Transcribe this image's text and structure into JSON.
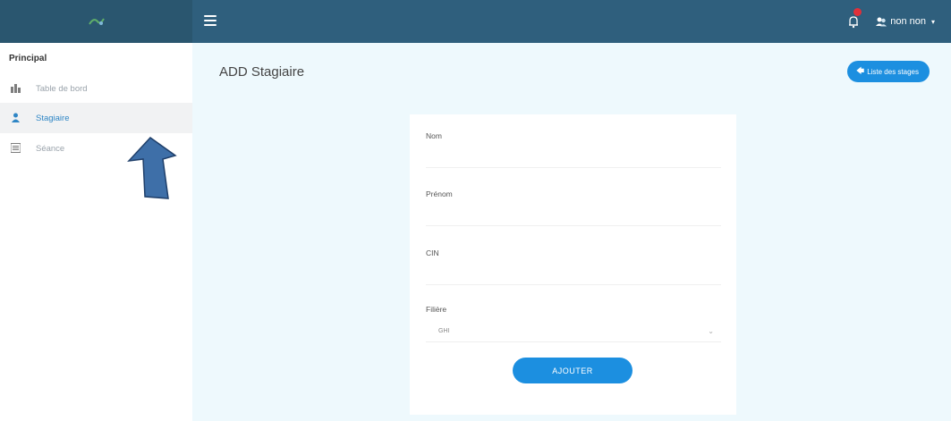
{
  "colors": {
    "topbar": "#2f5f7d",
    "accent": "#1c8fe0",
    "content_bg": "#eef9fd",
    "badge": "#e0303a",
    "arrow": "#3e6fa8"
  },
  "header": {
    "menu_icon": "hamburger-icon",
    "bell_icon": "bell-icon",
    "user": {
      "name": "non non",
      "avatar_icon": "user-group-icon",
      "caret": "▾"
    }
  },
  "sidebar": {
    "heading": "Principal",
    "items": [
      {
        "label": "Table de bord",
        "icon": "dashboard-icon",
        "active": false
      },
      {
        "label": "Stagiaire",
        "icon": "user-icon",
        "active": true
      },
      {
        "label": "Séance",
        "icon": "list-icon",
        "active": false
      }
    ]
  },
  "main": {
    "title": "ADD Stagiaire",
    "list_button": {
      "label": "Liste des stages",
      "icon": "arrow-left-icon",
      "arrow": "🡄"
    },
    "form": {
      "fields": [
        {
          "label": "Nom",
          "value": ""
        },
        {
          "label": "Prénom",
          "value": ""
        },
        {
          "label": "CIN",
          "value": ""
        }
      ],
      "select": {
        "label": "Filière",
        "value": "GHI",
        "caret": "⌄"
      },
      "submit_label": "AJOUTER"
    }
  },
  "annotation": {
    "icon": "arrow-up-icon"
  }
}
